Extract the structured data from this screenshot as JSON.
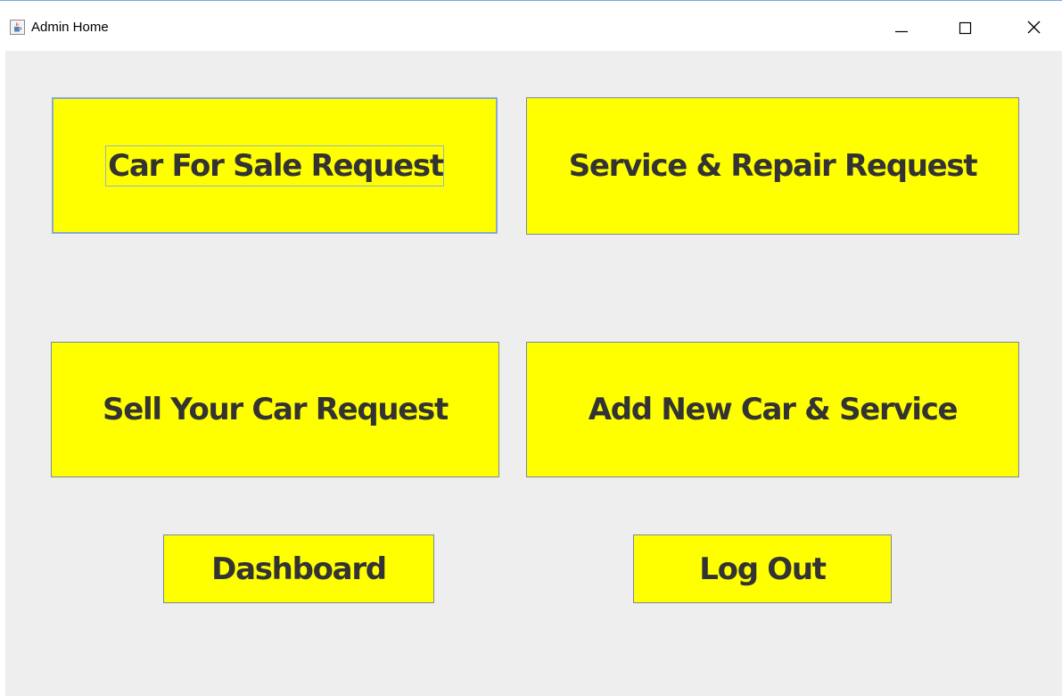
{
  "window": {
    "title": "Admin Home",
    "app_icon": "java-cup-icon",
    "controls": [
      "minimize-icon",
      "maximize-icon",
      "close-icon"
    ]
  },
  "colors": {
    "button_bg": "#ffff00",
    "button_text": "#333333",
    "content_bg": "#eeeeee",
    "focus_border": "#8aa9cf"
  },
  "buttons": {
    "car_for_sale": "Car For Sale Request",
    "service_repair": "Service & Repair Request",
    "sell_your_car": "Sell Your Car Request",
    "add_new_car": "Add New Car & Service",
    "dashboard": "Dashboard",
    "log_out": "Log Out"
  }
}
